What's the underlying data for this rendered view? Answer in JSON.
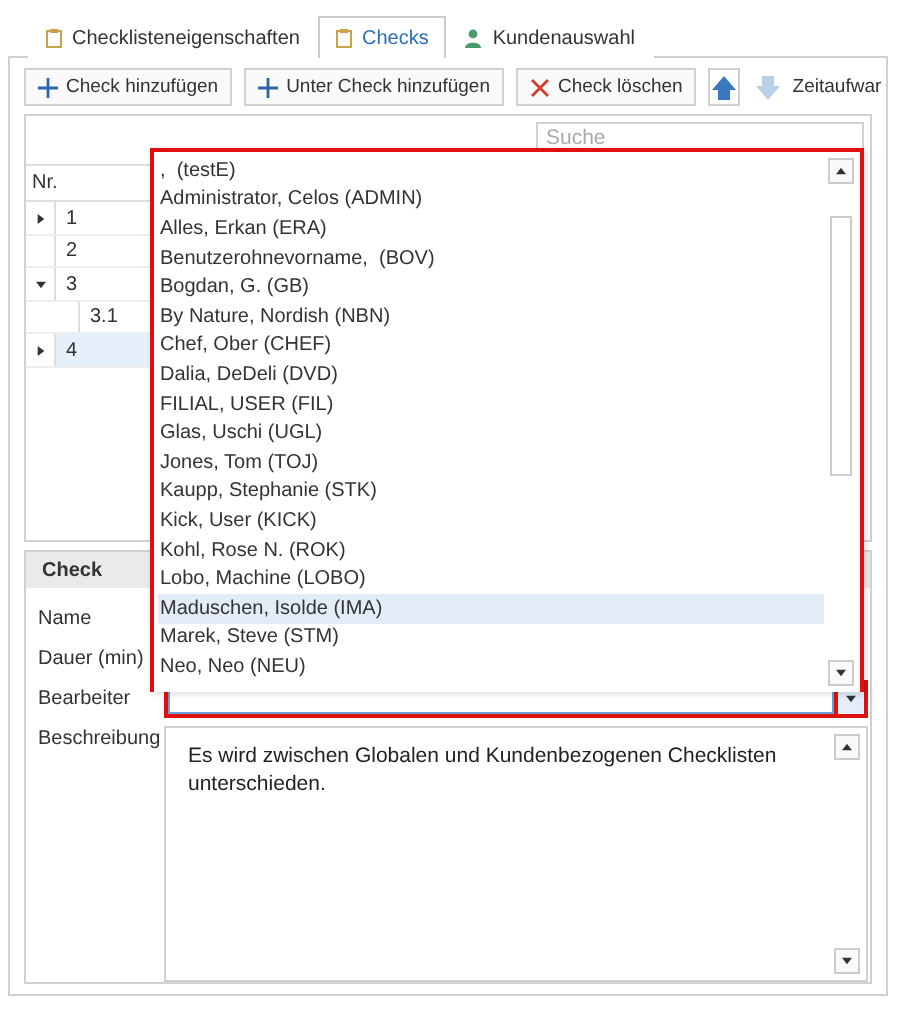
{
  "tabs": [
    {
      "label": "Checklisteneigenschaften",
      "selected": false
    },
    {
      "label": "Checks",
      "selected": true
    },
    {
      "label": "Kundenauswahl",
      "selected": false
    }
  ],
  "toolbar": {
    "buttons": [
      {
        "label": "Check hinzufügen",
        "kind": "add"
      },
      {
        "label": "Unter Check hinzufügen",
        "kind": "add"
      },
      {
        "label": "Check löschen",
        "kind": "remove"
      }
    ],
    "move_buttons": [
      {
        "kind": "up",
        "disabled": false
      },
      {
        "kind": "down",
        "disabled": true
      }
    ],
    "label": "Zeitaufwar"
  },
  "tree": {
    "search": {
      "placeholder": "Suche"
    },
    "column": "Nr.",
    "rows": [
      {
        "label": "1",
        "expanded": false,
        "selected": false
      },
      {
        "label": "2",
        "selected": false
      },
      {
        "label": "3",
        "expanded": true,
        "selected": false,
        "children": [
          {
            "label": "3.1",
            "selected": false
          }
        ]
      },
      {
        "label": "4",
        "expanded": false,
        "selected": true
      }
    ]
  },
  "check": {
    "title": "Check",
    "fields": [
      {
        "label": "Name",
        "kind": "hidden"
      },
      {
        "label": "Dauer (min)",
        "kind": "hidden"
      },
      {
        "label": "Bearbeiter",
        "kind": "combo",
        "open": true,
        "options": [
          {
            "label": ",  (testE)",
            "selected": false
          },
          {
            "label": "Administrator, Celos (ADMIN)",
            "selected": false
          },
          {
            "label": "Alles, Erkan (ERA)",
            "selected": false
          },
          {
            "label": "Benutzerohnevorname,  (BOV)",
            "selected": false
          },
          {
            "label": "Bogdan, G. (GB)",
            "selected": false
          },
          {
            "label": "By Nature, Nordish (NBN)",
            "selected": false
          },
          {
            "label": "Chef, Ober (CHEF)",
            "selected": false
          },
          {
            "label": "Dalia, DeDeli (DVD)",
            "selected": false
          },
          {
            "label": "FILIAL, USER (FIL)",
            "selected": false
          },
          {
            "label": "Glas, Uschi (UGL)",
            "selected": false
          },
          {
            "label": "Jones, Tom (TOJ)",
            "selected": false
          },
          {
            "label": "Kaupp, Stephanie (STK)",
            "selected": false
          },
          {
            "label": "Kick, User (KICK)",
            "selected": false
          },
          {
            "label": "Kohl, Rose N. (ROK)",
            "selected": false
          },
          {
            "label": "Lobo, Machine (LOBO)",
            "selected": false
          },
          {
            "label": "Maduschen, Isolde (IMA)",
            "selected": true
          },
          {
            "label": "Marek, Steve (STM)",
            "selected": false
          },
          {
            "label": "Neo, Neo (NEU)",
            "selected": false
          }
        ]
      },
      {
        "label": "Beschreibung",
        "kind": "textarea",
        "value": "Es wird zwischen Globalen und Kundenbezogenen Checklisten unterschieden."
      }
    ]
  }
}
